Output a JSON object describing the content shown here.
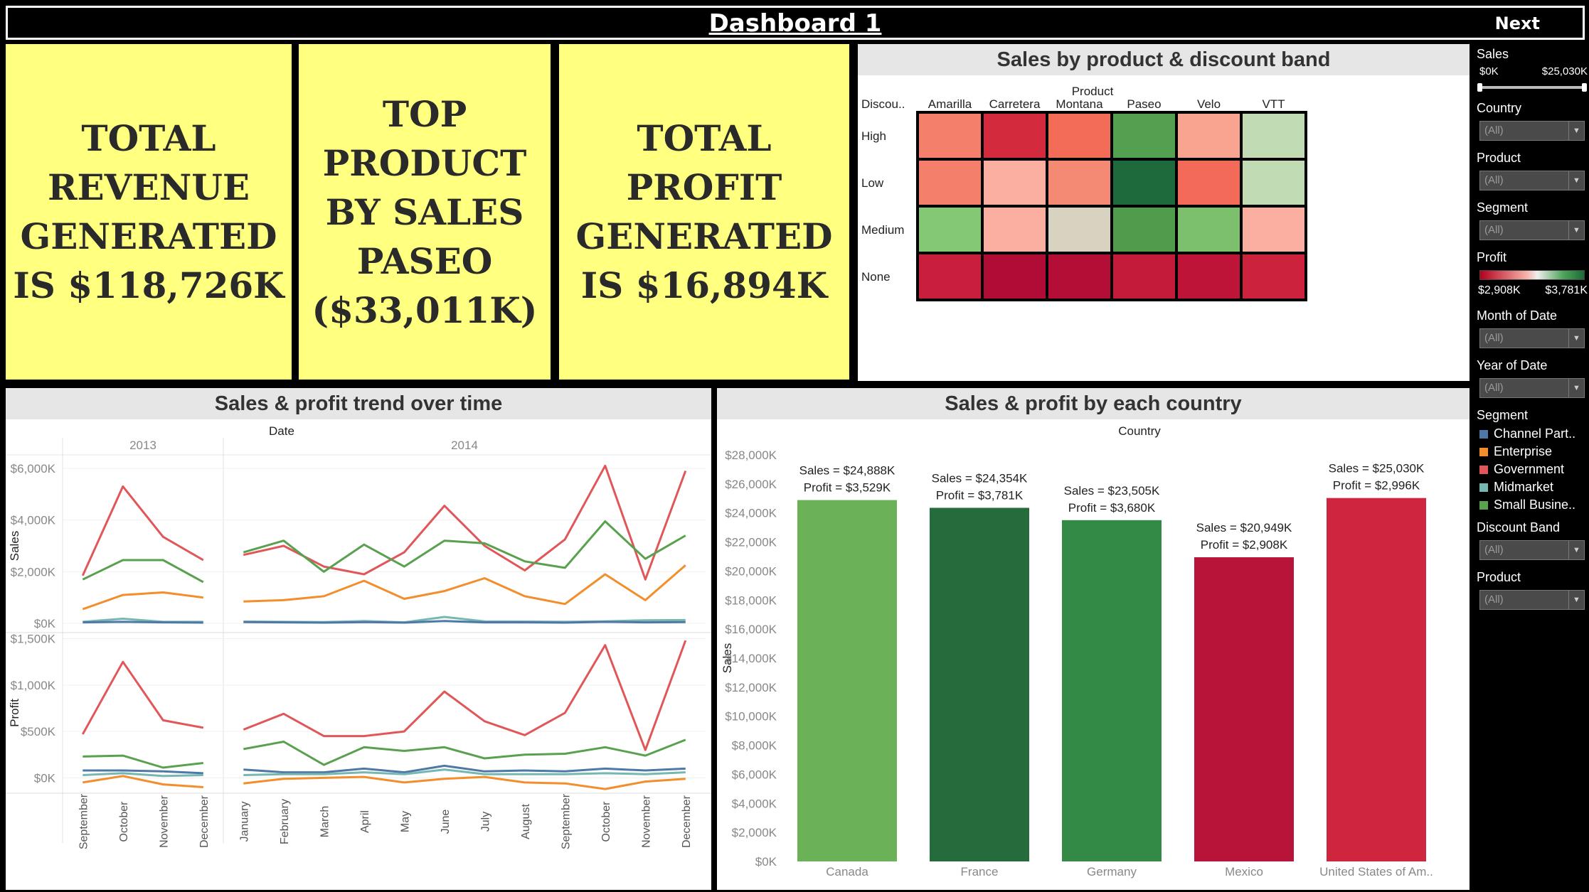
{
  "header": {
    "title": "Dashboard 1",
    "next_label": "Next"
  },
  "kpis": [
    {
      "text": "TOTAL\nREVENUE\nGENERATED\nIS $118,726K"
    },
    {
      "text": "TOP PRODUCT\nBY SALES\nPASEO\n($33,011K)"
    },
    {
      "text": "TOTAL PROFIT\nGENERATED\nIS $16,894K"
    }
  ],
  "filters": {
    "sales_title": "Sales",
    "sales_min": "$0K",
    "sales_max": "$25,030K",
    "country_label": "Country",
    "country_value": "(All)",
    "product_label": "Product",
    "product_value": "(All)",
    "segment_label": "Segment",
    "segment_value": "(All)",
    "profit_title": "Profit",
    "profit_min": "$2,908K",
    "profit_max": "$3,781K",
    "month_label": "Month of Date",
    "month_value": "(All)",
    "year_label": "Year of Date",
    "year_value": "(All)",
    "segment_legend_title": "Segment",
    "segment_legend": [
      {
        "label": "Channel Part..",
        "color": "#4e79a7"
      },
      {
        "label": "Enterprise",
        "color": "#f28e2b"
      },
      {
        "label": "Government",
        "color": "#e15759"
      },
      {
        "label": "Midmarket",
        "color": "#76b7b2"
      },
      {
        "label": "Small Busine..",
        "color": "#59a14f"
      }
    ],
    "discount_label": "Discount Band",
    "discount_value": "(All)",
    "product2_label": "Product",
    "product2_value": "(All)"
  },
  "chart_data": [
    {
      "type": "heatmap",
      "title": "Sales by product & discount band",
      "x_header": "Product",
      "y_header": "Discou..",
      "columns": [
        "Amarilla",
        "Carretera",
        "Montana",
        "Paseo",
        "Velo",
        "VTT"
      ],
      "rows": [
        "High",
        "Low",
        "Medium",
        "None"
      ],
      "color_scale": {
        "measure": "Profit",
        "low_color": "#b3001e",
        "mid_color": "#d8d2c0",
        "high_color": "#1d6a38"
      },
      "cell_colors": [
        [
          "#f4806c",
          "#d42a3e",
          "#f36c58",
          "#52a050",
          "#f9a490",
          "#c1dcb4"
        ],
        [
          "#f4806c",
          "#fbafa0",
          "#f58a74",
          "#1f6a3d",
          "#f36b58",
          "#c1dcb4"
        ],
        [
          "#84c875",
          "#fbafa0",
          "#d8d2c0",
          "#4f9d4c",
          "#7cc06e",
          "#fbafa0"
        ],
        [
          "#ca1f3c",
          "#b00c35",
          "#b40e37",
          "#c51b3b",
          "#bd1438",
          "#cd223e"
        ]
      ]
    },
    {
      "type": "line",
      "title": "Sales & profit trend over time",
      "x_header": "Date",
      "years": [
        {
          "label": "2013",
          "count": 4
        },
        {
          "label": "2014",
          "count": 12
        }
      ],
      "x": [
        "September",
        "October",
        "November",
        "December",
        "January",
        "February",
        "March",
        "April",
        "May",
        "June",
        "July",
        "August",
        "September",
        "October",
        "November",
        "December"
      ],
      "panels": [
        {
          "ylabel": "Sales",
          "ylim": [
            -300,
            6300
          ],
          "ticks": [
            0,
            2000,
            4000,
            6000
          ],
          "tick_labels": [
            "$0K",
            "$2,000K",
            "$4,000K",
            "$6,000K"
          ],
          "series": [
            {
              "name": "Government",
              "color": "#e15759",
              "values": [
                1850,
                5300,
                3350,
                2450,
                2650,
                3000,
                2200,
                1900,
                2750,
                4550,
                3000,
                2050,
                3250,
                6100,
                1700,
                5900
              ]
            },
            {
              "name": "Small Business",
              "color": "#59a14f",
              "values": [
                1700,
                2450,
                2450,
                1600,
                2750,
                3200,
                2000,
                3050,
                2200,
                3200,
                3100,
                2400,
                2150,
                3950,
                2500,
                3400
              ]
            },
            {
              "name": "Enterprise",
              "color": "#f28e2b",
              "values": [
                550,
                1100,
                1200,
                1000,
                850,
                900,
                1050,
                1650,
                950,
                1250,
                1750,
                1050,
                750,
                1900,
                900,
                2250
              ]
            },
            {
              "name": "Midmarket",
              "color": "#76b7b2",
              "values": [
                60,
                180,
                60,
                60,
                70,
                60,
                50,
                90,
                40,
                250,
                80,
                70,
                60,
                80,
                120,
                130
              ]
            },
            {
              "name": "Channel Partners",
              "color": "#4e79a7",
              "values": [
                40,
                60,
                40,
                30,
                50,
                40,
                30,
                50,
                30,
                90,
                40,
                40,
                30,
                60,
                40,
                50
              ]
            }
          ]
        },
        {
          "ylabel": "Profit",
          "ylim": [
            -150,
            1550
          ],
          "ticks": [
            0,
            500,
            1000,
            1500
          ],
          "tick_labels": [
            "$0K",
            "$500K",
            "$1,000K",
            "$1,500K"
          ],
          "series": [
            {
              "name": "Government",
              "color": "#e15759",
              "values": [
                470,
                1250,
                620,
                540,
                520,
                690,
                450,
                450,
                500,
                930,
                610,
                460,
                700,
                1430,
                300,
                1480
              ]
            },
            {
              "name": "Small Business",
              "color": "#59a14f",
              "values": [
                230,
                240,
                110,
                160,
                310,
                390,
                140,
                330,
                290,
                330,
                210,
                250,
                260,
                330,
                240,
                410
              ]
            },
            {
              "name": "Channel Partners",
              "color": "#4e79a7",
              "values": [
                80,
                80,
                70,
                50,
                90,
                60,
                60,
                100,
                60,
                130,
                70,
                80,
                70,
                100,
                80,
                100
              ]
            },
            {
              "name": "Midmarket",
              "color": "#76b7b2",
              "values": [
                30,
                50,
                20,
                30,
                30,
                40,
                40,
                60,
                40,
                90,
                40,
                40,
                40,
                50,
                40,
                60
              ]
            },
            {
              "name": "Enterprise",
              "color": "#f28e2b",
              "values": [
                -50,
                20,
                -70,
                -100,
                -60,
                -10,
                0,
                10,
                -50,
                -10,
                10,
                -50,
                -60,
                -120,
                -40,
                -10
              ]
            }
          ]
        }
      ]
    },
    {
      "type": "bar",
      "title": "Sales & profit by each country",
      "x_header": "Country",
      "ylabel": "Sales",
      "ylim": [
        0,
        28000
      ],
      "ticks": [
        0,
        2000,
        4000,
        6000,
        8000,
        10000,
        12000,
        14000,
        16000,
        18000,
        20000,
        22000,
        24000,
        26000,
        28000
      ],
      "tick_labels": [
        "$0K",
        "$2,000K",
        "$4,000K",
        "$6,000K",
        "$8,000K",
        "$10,000K",
        "$12,000K",
        "$14,000K",
        "$16,000K",
        "$18,000K",
        "$20,000K",
        "$22,000K",
        "$24,000K",
        "$26,000K",
        "$28,000K"
      ],
      "categories": [
        "Canada",
        "France",
        "Germany",
        "Mexico",
        "United States of Am.."
      ],
      "values": [
        24888,
        24354,
        23505,
        20949,
        25030
      ],
      "colors": [
        "#6ab158",
        "#256c3c",
        "#328a46",
        "#b8143a",
        "#d0253f"
      ],
      "sales_labels": [
        "Sales = $24,888K",
        "Sales = $24,354K",
        "Sales = $23,505K",
        "Sales = $20,949K",
        "Sales = $25,030K"
      ],
      "profit_labels": [
        "Profit = $3,529K",
        "Profit = $3,781K",
        "Profit = $3,680K",
        "Profit = $2,908K",
        "Profit = $2,996K"
      ]
    }
  ]
}
